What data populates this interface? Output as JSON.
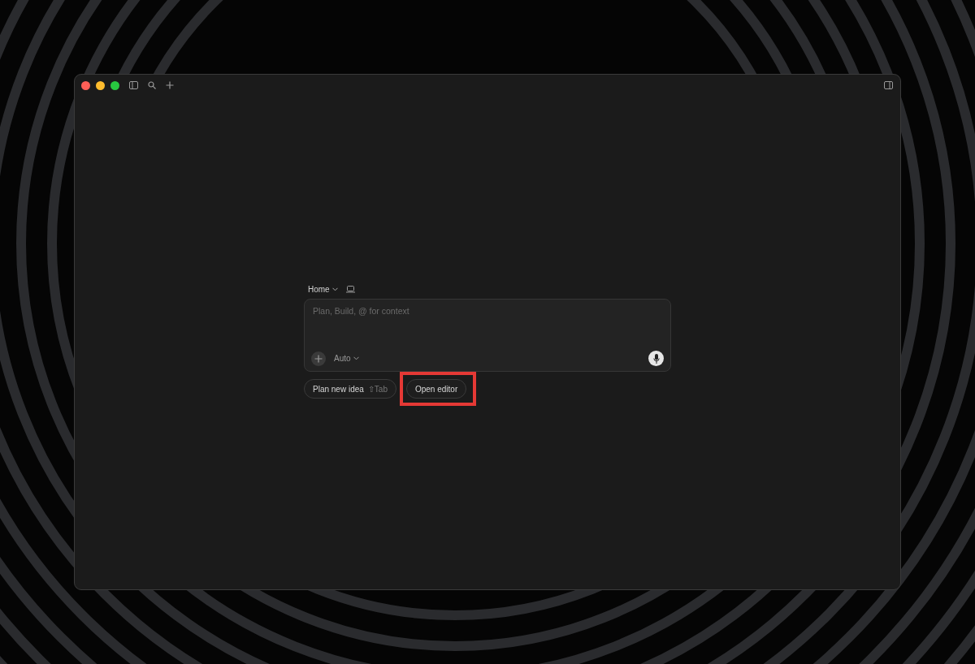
{
  "window": {
    "traffic_lights": [
      {
        "color": "#ff5f57"
      },
      {
        "color": "#febc2e"
      },
      {
        "color": "#28c840"
      }
    ]
  },
  "workspace": {
    "label": "Home"
  },
  "composer": {
    "placeholder": "Plan, Build, @ for context",
    "mode": "Auto"
  },
  "actions": [
    {
      "label": "Plan new idea",
      "shortcut": "⇧Tab",
      "highlighted": false
    },
    {
      "label": "Open editor",
      "highlighted": true
    }
  ]
}
